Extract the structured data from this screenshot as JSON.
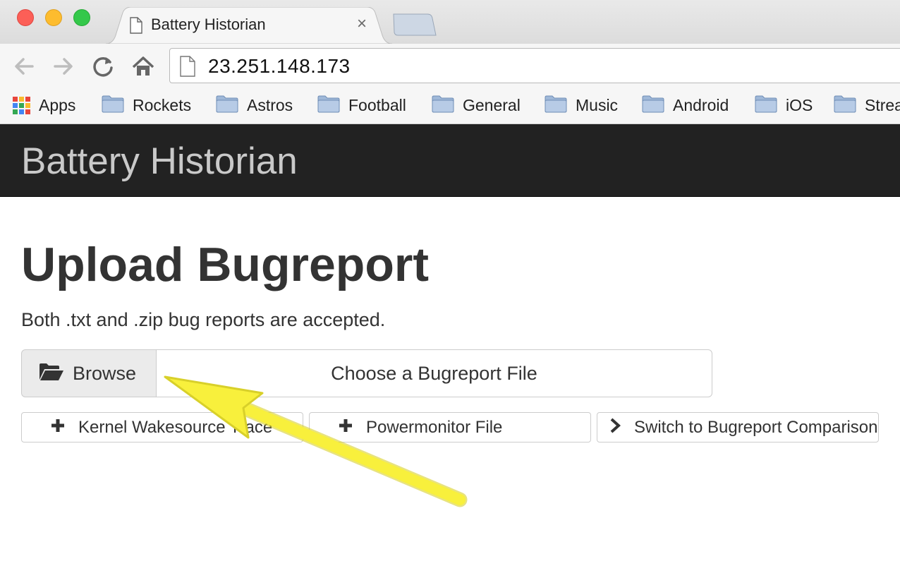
{
  "window": {
    "tab_title": "Battery Historian",
    "tab_close": "×",
    "controls": [
      "close",
      "minimize",
      "zoom"
    ]
  },
  "toolbar": {
    "url": "23.251.148.173",
    "icons": [
      "back-icon",
      "forward-icon",
      "reload-icon",
      "home-icon"
    ]
  },
  "bookmarks": {
    "items": [
      {
        "label": "Apps",
        "icon": "apps-grid-icon"
      },
      {
        "label": "Rockets",
        "icon": "folder-icon"
      },
      {
        "label": "Astros",
        "icon": "folder-icon"
      },
      {
        "label": "Football",
        "icon": "folder-icon"
      },
      {
        "label": "General",
        "icon": "folder-icon"
      },
      {
        "label": "Music",
        "icon": "folder-icon"
      },
      {
        "label": "Android",
        "icon": "folder-icon"
      },
      {
        "label": "iOS",
        "icon": "folder-icon"
      },
      {
        "label": "Strea",
        "icon": "folder-icon"
      }
    ]
  },
  "navbar": {
    "brand": "Battery Historian"
  },
  "main": {
    "title": "Upload Bugreport",
    "subtitle": "Both .txt and .zip bug reports are accepted.",
    "browse_label": "Browse",
    "file_placeholder": "Choose a Bugreport File",
    "buttons": [
      {
        "label": "Kernel Wakesource Trace",
        "icon": "plus-icon"
      },
      {
        "label": "Powermonitor File",
        "icon": "plus-icon"
      },
      {
        "label": "Switch to Bugreport Comparison",
        "icon": "chevron-right-icon"
      }
    ]
  },
  "annotation": {
    "arrow_color": "#f8f03c",
    "points_to": "Browse"
  },
  "colors": {
    "navbar_bg": "#222222",
    "brand_text": "#c9c9c9",
    "title_text": "#333333"
  }
}
